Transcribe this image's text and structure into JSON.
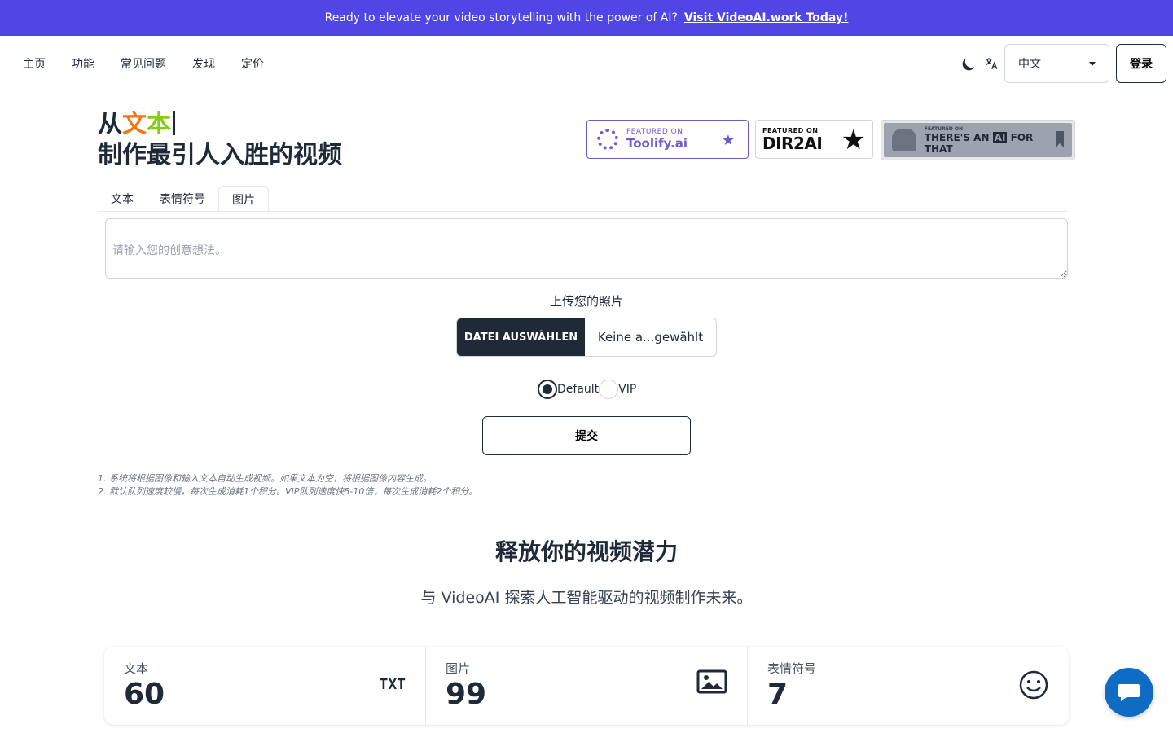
{
  "banner": {
    "text": "Ready to elevate your video storytelling with the power of AI?",
    "link": "Visit VideoAI.work Today!",
    "bg_color": "#4f46e5"
  },
  "nav": {
    "links": [
      "主页",
      "功能",
      "常见问题",
      "发现",
      "定价"
    ],
    "theme_icon": "moon-icon",
    "translate_icon": "translate-icon",
    "language": "中文",
    "login": "登录"
  },
  "hero": {
    "prefix": "从",
    "word_chars": [
      "文",
      "本"
    ],
    "line2": "制作最引人入胜的视频"
  },
  "badges": {
    "toolify": {
      "small": "FEATURED ON",
      "big": "Toolify.ai"
    },
    "dir2ai": {
      "small": "FEATURED ON",
      "big": "DIR2AI"
    },
    "aift": {
      "small": "FEATURED ON",
      "big_pre": "THERE'S AN",
      "ai": "AI",
      "big_post": "FOR THAT"
    }
  },
  "tabs": [
    "文本",
    "表情符号",
    "图片"
  ],
  "active_tab": "图片",
  "form": {
    "placeholder": "请输入您的创意想法。",
    "upload_label": "上传您的照片",
    "file_button": "DATEI AUSWÄHLEN",
    "file_name": "Keine a...gewählt",
    "radio_default": "Default",
    "radio_vip": "VIP",
    "selected_queue": "Default",
    "submit": "提交"
  },
  "notes": [
    "1. 系统将根据图像和输入文本自动生成视频。如果文本为空，将根据图像内容生成。",
    "2. 默认队列速度较慢，每次生成消耗1个积分。VIP队列速度快5-10倍，每次生成消耗2个积分。"
  ],
  "section": {
    "title": "释放你的视频潜力",
    "subtitle": "与 VideoAI 探索人工智能驱动的视频制作未来。"
  },
  "stats": [
    {
      "title": "文本",
      "value": "60",
      "icon": "txt-icon",
      "icon_text": "TXT"
    },
    {
      "title": "图片",
      "value": "99",
      "icon": "image-icon"
    },
    {
      "title": "表情符号",
      "value": "7",
      "icon": "smiley-icon"
    }
  ],
  "chat": {
    "icon": "chat-icon",
    "color": "#0f6cc4"
  }
}
